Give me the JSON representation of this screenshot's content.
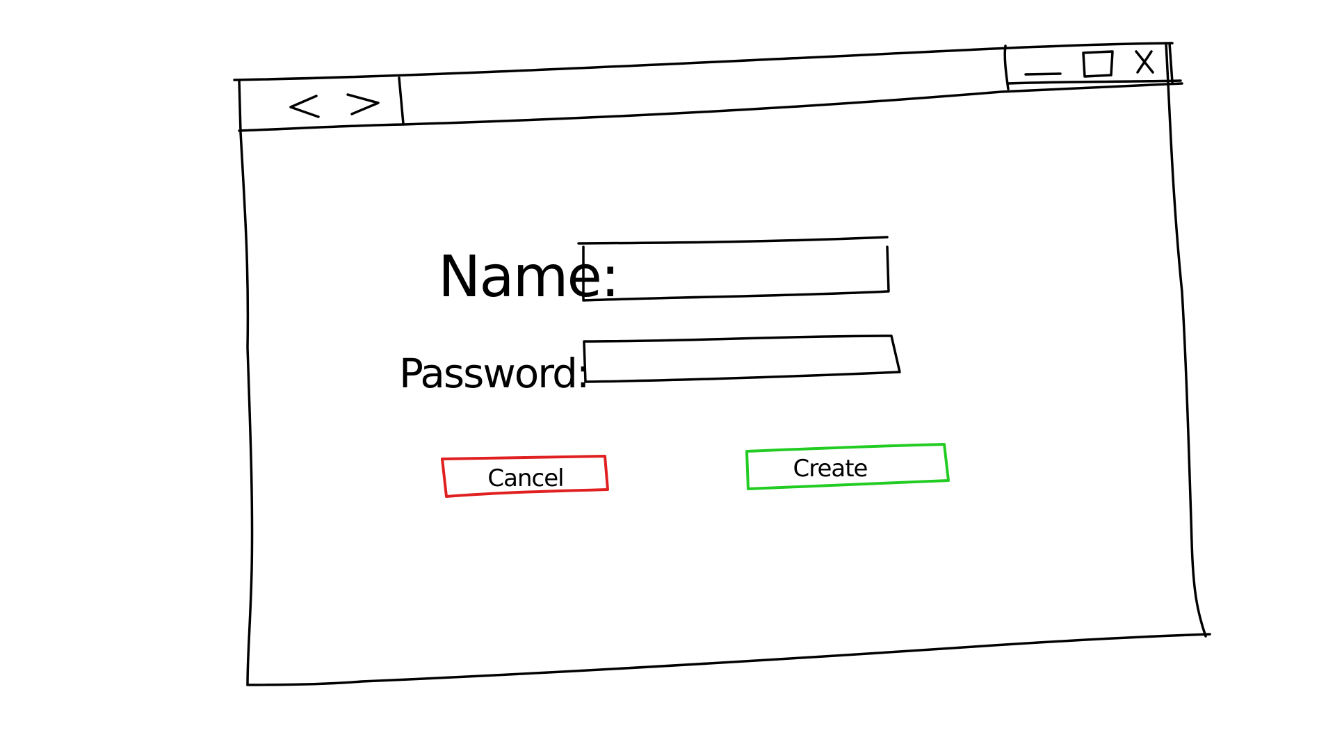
{
  "window": {
    "nav": {
      "back_glyph": "<",
      "forward_glyph": ">"
    },
    "controls": {
      "minimize": "minimize-icon",
      "maximize": "maximize-icon",
      "close_glyph": "X"
    }
  },
  "form": {
    "name_label": "Name:",
    "name_value": "",
    "password_label": "Password:",
    "password_value": ""
  },
  "buttons": {
    "cancel_label": "Cancel",
    "cancel_color": "#e02020",
    "create_label": "Create",
    "create_color": "#22cc22"
  }
}
